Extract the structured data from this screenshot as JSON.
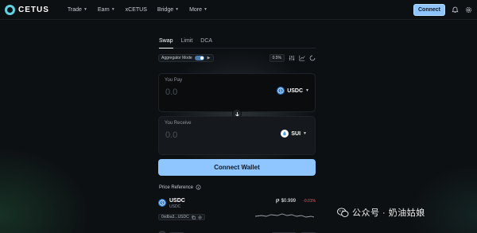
{
  "brand": {
    "name": "CETUS"
  },
  "nav": [
    {
      "label": "Trade",
      "has_caret": true
    },
    {
      "label": "Earn",
      "has_caret": true
    },
    {
      "label": "xCETUS",
      "has_caret": false
    },
    {
      "label": "Bridge",
      "has_caret": true
    },
    {
      "label": "More",
      "has_caret": true
    }
  ],
  "header": {
    "connect_label": "Connect",
    "icons": [
      "bell-icon",
      "gear-icon"
    ]
  },
  "swap": {
    "tabs": [
      {
        "label": "Swap",
        "active": true
      },
      {
        "label": "Limit",
        "active": false
      },
      {
        "label": "DCA",
        "active": false
      }
    ],
    "aggregator_label": "Aggregator Mode",
    "aggregator_on": true,
    "slippage": "0.5%",
    "pay": {
      "label": "You Pay",
      "amount": "0.0",
      "token": "USDC"
    },
    "receive": {
      "label": "You Receive",
      "amount": "0.0",
      "token": "SUI"
    },
    "button_label": "Connect Wallet"
  },
  "price_reference": {
    "title": "Price Reference",
    "rows": [
      {
        "symbol": "USDC",
        "name": "USDC",
        "price": "$0.999",
        "change": "-0.01%",
        "address": "0xdba3...USDC"
      }
    ]
  },
  "watermark": {
    "text": "公众号 · 奶油姑娘"
  },
  "colors": {
    "accent": "#8fc6ff",
    "negative": "#ff5a5a",
    "toggle": "#4a79b0"
  }
}
